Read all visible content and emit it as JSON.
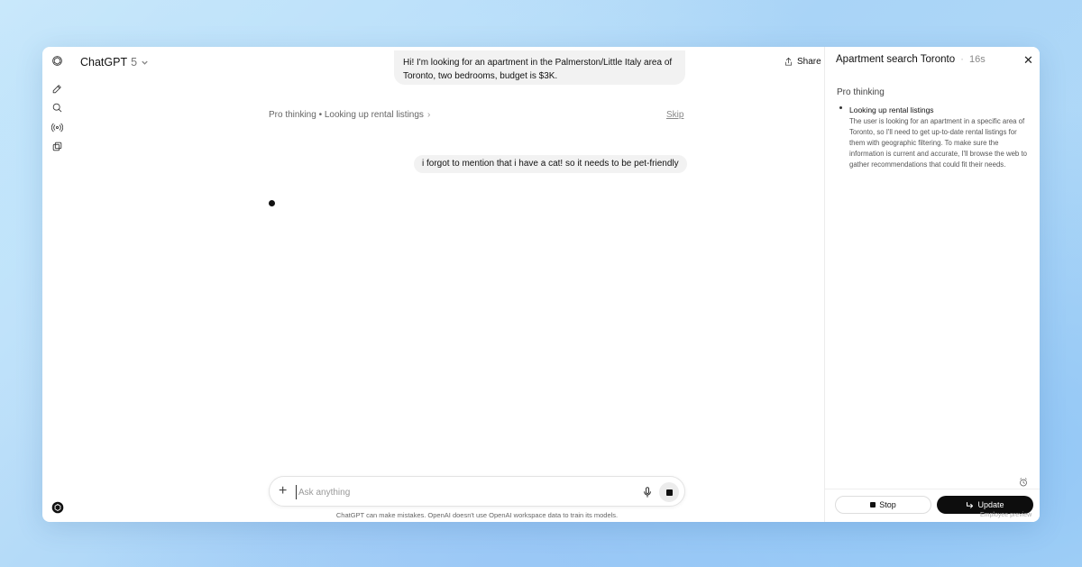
{
  "app": {
    "model_name": "ChatGPT",
    "model_version": "5",
    "share_label": "Share",
    "more_label": "···"
  },
  "rail": {
    "icons": [
      "openai-logo-icon",
      "new-chat-icon",
      "search-icon",
      "voice-icon",
      "library-icon",
      "profile-icon"
    ]
  },
  "conversation": {
    "messages": [
      "Hi! I'm looking for an apartment in the Palmerston/Little Italy area of Toronto, two bedrooms, budget is $3K.",
      "i forgot to mention that i have a cat! so it needs to be pet-friendly"
    ],
    "thinking_status": "Pro thinking • Looking up rental listings",
    "thinking_chevron": "›",
    "skip_label": "Skip"
  },
  "composer": {
    "plus_label": "+",
    "placeholder": "Ask anything",
    "value": ""
  },
  "disclaimer": "ChatGPT can make mistakes. OpenAI doesn't use OpenAI workspace data to train its models.",
  "panel": {
    "title": "Apartment search Toronto",
    "separator": "·",
    "elapsed": "16s",
    "close_label": "✕",
    "section_label": "Pro thinking",
    "item_title": "Looking up rental listings",
    "item_body": "The user is looking for an apartment in a specific area of Toronto, so I'll need to get up-to-date rental listings for them with geographic filtering. To make sure the information is current and accurate, I'll browse the web to gather recommendations that could fit their needs.",
    "stop_label": "Stop",
    "update_label": "Update",
    "preview_label": "Employee preview"
  }
}
